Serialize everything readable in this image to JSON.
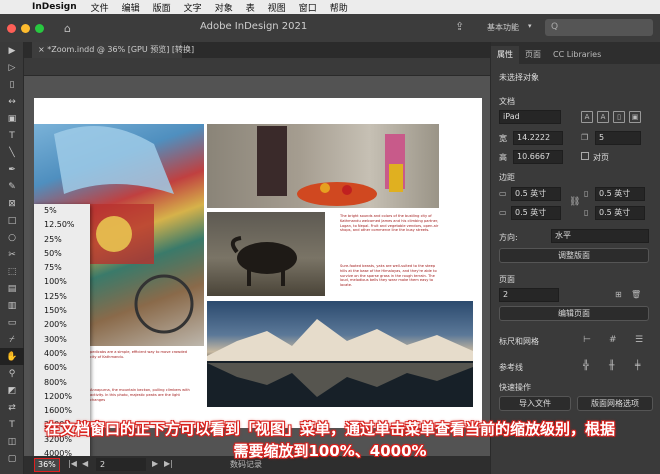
{
  "menubar": {
    "app": "InDesign",
    "items": [
      "文件",
      "编辑",
      "版面",
      "文字",
      "对象",
      "表",
      "视图",
      "窗口",
      "帮助"
    ]
  },
  "titlebar": {
    "title": "Adobe InDesign 2021",
    "workspace": "基本功能",
    "search_placeholder": "Q"
  },
  "colors": {
    "close": "#fe5f57",
    "minimize": "#febc2e",
    "maximize": "#28c840",
    "highlight": "#e02020",
    "caption_outline": "#d8201c"
  },
  "document": {
    "tab_label": "*Zoom.indd @ 36% [GPU 预览] [转换]",
    "close_icon": "×"
  },
  "statusbar": {
    "zoom": "36%",
    "page": "2",
    "preflight": "数码记录"
  },
  "zoom_menu": [
    "5%",
    "12.50%",
    "25%",
    "50%",
    "75%",
    "100%",
    "125%",
    "150%",
    "200%",
    "300%",
    "400%",
    "600%",
    "800%",
    "1200%",
    "1600%",
    "2400%",
    "3200%",
    "4000%"
  ],
  "panel": {
    "tabs": [
      "属性",
      "页面",
      "CC Libraries"
    ],
    "selection": "未选择对象",
    "document_label": "文档",
    "preset": "iPad",
    "width_label": "宽",
    "width": "14.2222",
    "height_label": "高",
    "height": "10.6667",
    "pages": "5",
    "facing": "对页",
    "margins_label": "边距",
    "margin_top": "0.5 英寸",
    "margin_bottom": "0.5 英寸",
    "margin_left": "0.5 英寸",
    "margin_right": "0.5 英寸",
    "direction_label": "方向:",
    "direction": "水平",
    "adjust_layout": "调整版面",
    "page_label": "页面",
    "page_value": "2",
    "edit_page": "编辑页面",
    "rulers_label": "标尺和网格",
    "guides_label": "参考线",
    "quick_label": "快速操作",
    "import_file": "导入文件",
    "layout_grid": "版面网格选项"
  },
  "page_text": {
    "p1": "The bright sounds and colors of the bustling city of Kathmandu welcomed James and his climbing partner, Logan, to Nepal. Fruit and vegetable vendors, open-air shops, and other commerce line the busy streets.",
    "p2": "Sure-footed beasts, yaks are well-suited to the steep hills at the base of the Himalayas, and they're able to survive on the sparse grass in the rough terrain. The loud, melodious bells they wear make them easy to locate.",
    "p3": "pedicabs are a simple, efficient way to move crowded city of Kathmandu.",
    "p4": "Annapurna, the mountain beckon, pulling climbers with activity. In this photo, majestic peaks are the light changes"
  },
  "caption": {
    "line1": "在文档窗口的正下方可以看到「视图」菜单，通过单击菜单查看当前的缩放级别，根据",
    "line2": "需要缩放到100%、4000%"
  }
}
